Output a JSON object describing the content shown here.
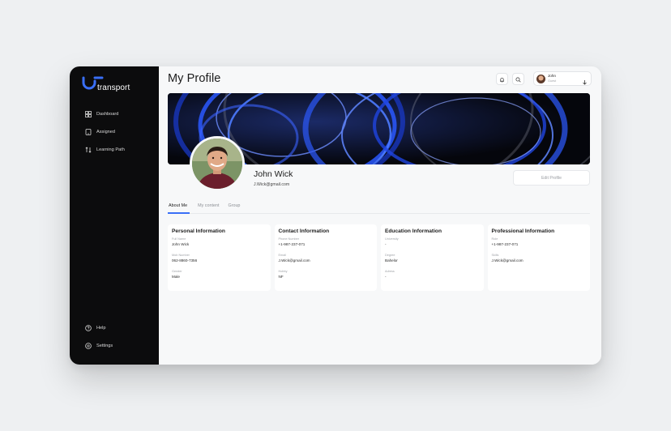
{
  "brand": {
    "name": "transport",
    "accent": "#3a6ff7"
  },
  "sidebar": {
    "items": [
      {
        "label": "Dashboard",
        "icon": "grid-icon"
      },
      {
        "label": "Assigned",
        "icon": "tablet-icon"
      },
      {
        "label": "Learning Path",
        "icon": "swap-icon"
      }
    ],
    "footer": [
      {
        "label": "Help",
        "icon": "help-icon"
      },
      {
        "label": "Settings",
        "icon": "settings-icon"
      }
    ]
  },
  "header": {
    "title": "My Profile",
    "user": {
      "name": "John",
      "role": "Guest"
    }
  },
  "profile": {
    "name": "John Wick",
    "email": "J.Wick@gmail.com",
    "edit_label": "Edit Profile"
  },
  "tabs": [
    {
      "label": "About Me",
      "active": true
    },
    {
      "label": "My content",
      "active": false
    },
    {
      "label": "Group",
      "active": false
    }
  ],
  "cards": [
    {
      "title": "Personal Information",
      "fields": [
        {
          "label": "Full Name",
          "value": "John Wick"
        },
        {
          "label": "Mob Number",
          "value": "062-8860-7356"
        },
        {
          "label": "Gender",
          "value": "Male"
        }
      ]
    },
    {
      "title": "Contact Information",
      "fields": [
        {
          "label": "Phone Number",
          "value": "+1-987-237-071"
        },
        {
          "label": "Email",
          "value": "J.Wick@gmail.com"
        },
        {
          "label": "Hobby",
          "value": "NF"
        }
      ]
    },
    {
      "title": "Education Information",
      "fields": [
        {
          "label": "University",
          "value": "-"
        },
        {
          "label": "Degree",
          "value": "Bahelor"
        },
        {
          "label": "Adress",
          "value": "-"
        }
      ]
    },
    {
      "title": "Professional Information",
      "fields": [
        {
          "label": "Role",
          "value": "+1-987-237-071"
        },
        {
          "label": "Skills",
          "value": "J.Wick@gmail.com"
        }
      ]
    }
  ]
}
